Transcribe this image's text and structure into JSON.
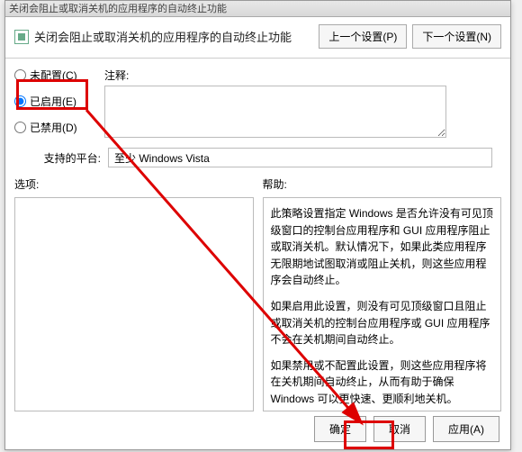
{
  "titlebar": "关闭会阻止或取消关机的应用程序的自动终止功能",
  "header": {
    "title": "关闭会阻止或取消关机的应用程序的自动终止功能",
    "prev_btn": "上一个设置(P)",
    "next_btn": "下一个设置(N)"
  },
  "radios": {
    "not_configured": "未配置(C)",
    "enabled": "已启用(E)",
    "disabled": "已禁用(D)",
    "selected": "enabled"
  },
  "notes": {
    "label": "注释:"
  },
  "platform": {
    "label": "支持的平台:",
    "value": "至少 Windows Vista"
  },
  "options": {
    "label": "选项:"
  },
  "help": {
    "label": "帮助:",
    "p1": "此策略设置指定 Windows 是否允许没有可见顶级窗口的控制台应用程序和 GUI 应用程序阻止或取消关机。默认情况下，如果此类应用程序无限期地试图取消或阻止关机，则这些应用程序会自动终止。",
    "p2": "如果启用此设置，则没有可见顶级窗口且阻止或取消关机的控制台应用程序或 GUI 应用程序不会在关机期间自动终止。",
    "p3": "如果禁用或不配置此设置，则这些应用程序将在关机期间自动终止，从而有助于确保 Windows 可以更快速、更顺利地关机。"
  },
  "footer": {
    "ok": "确定",
    "cancel": "取消",
    "apply": "应用(A)"
  }
}
